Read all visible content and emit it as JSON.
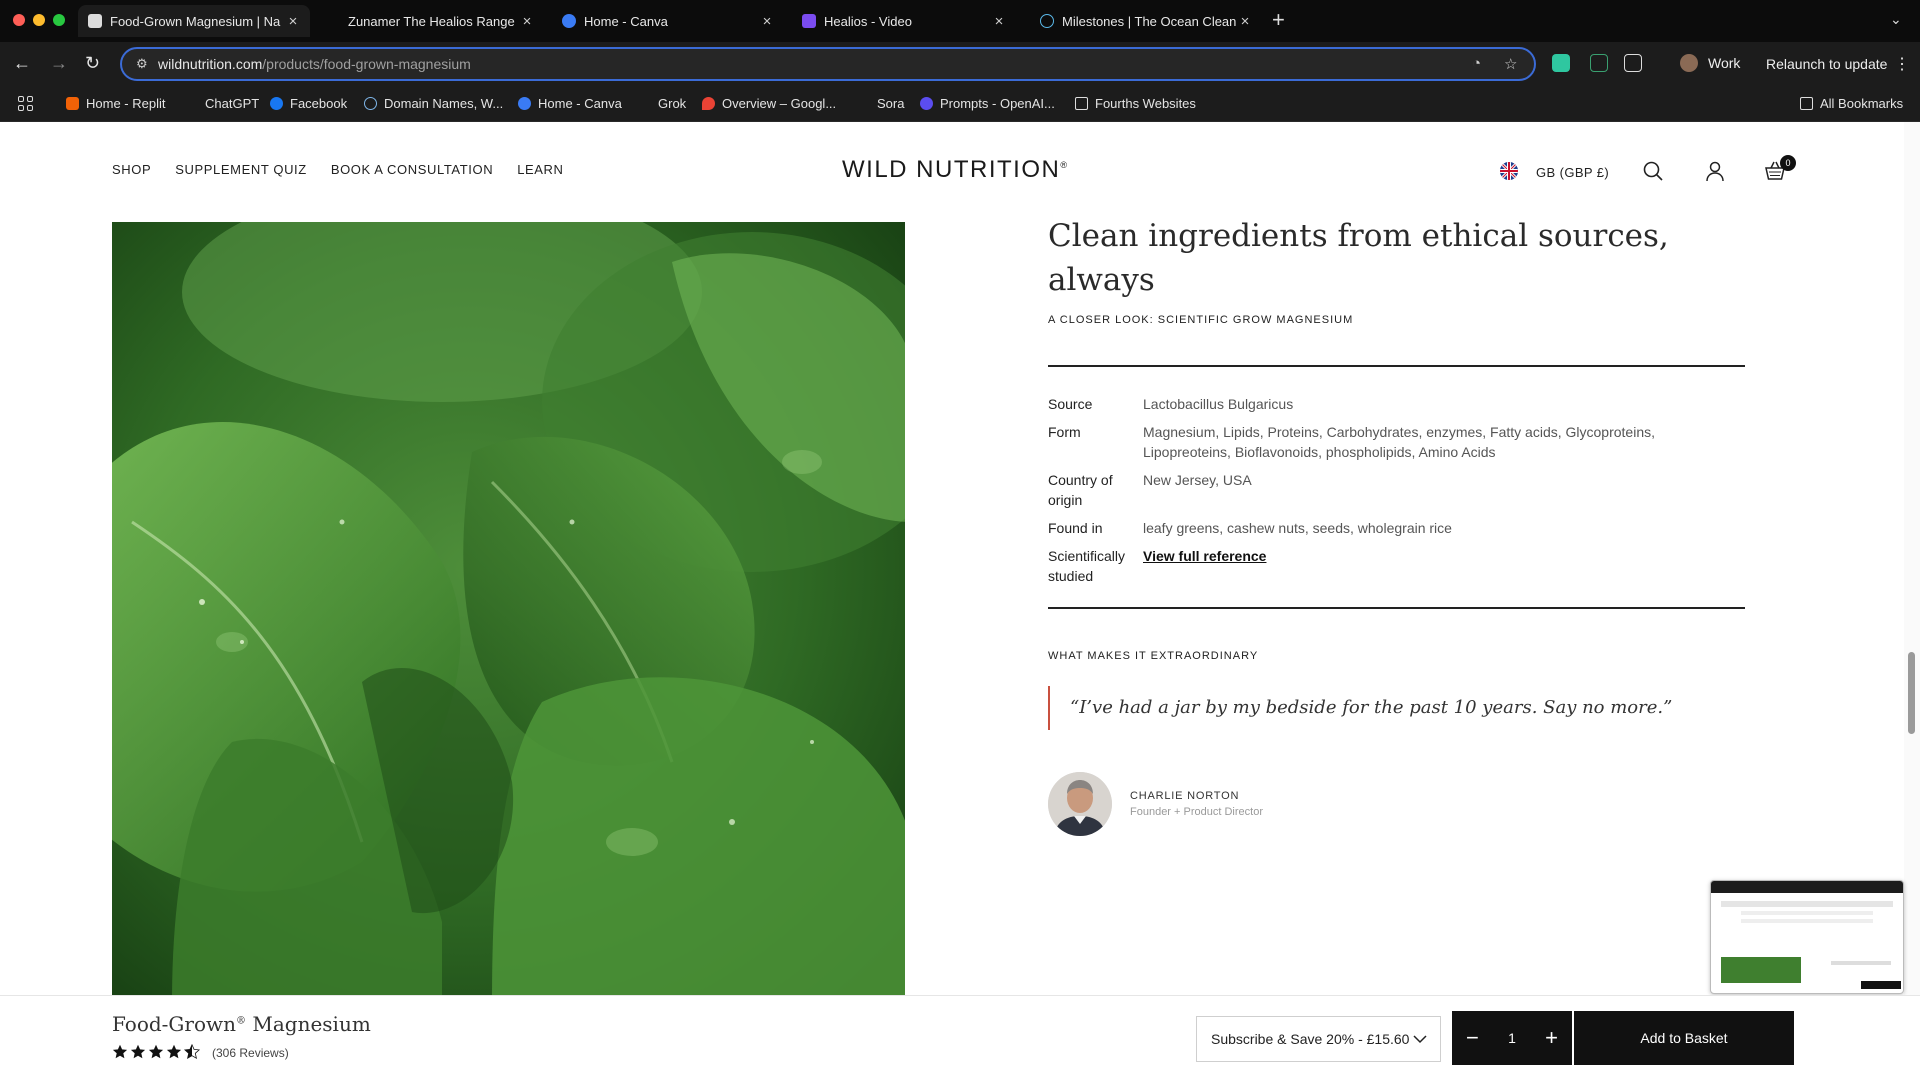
{
  "browser": {
    "tabs": [
      {
        "title": "Food-Grown Magnesium | Na",
        "active": true
      },
      {
        "title": "Zunamer The Healios Range",
        "active": false
      },
      {
        "title": "Home - Canva",
        "active": false
      },
      {
        "title": "Healios - Video",
        "active": false
      },
      {
        "title": "Milestones | The Ocean Clean",
        "active": false
      }
    ],
    "new_tab": "+",
    "url_host": "wildnutrition.com",
    "url_path": "/products/food-grown-magnesium",
    "profile_label": "Work",
    "relaunch_label": "Relaunch to update",
    "bookmarks": [
      "Home - Replit",
      "ChatGPT",
      "Facebook",
      "Domain Names, W...",
      "Home - Canva",
      "Grok",
      "Overview – Googl...",
      "Sora",
      "Prompts - OpenAI...",
      "Fourths Websites"
    ],
    "all_bookmarks": "All Bookmarks"
  },
  "header": {
    "nav": [
      "SHOP",
      "SUPPLEMENT QUIZ",
      "BOOK A CONSULTATION",
      "LEARN"
    ],
    "brand": "WILD NUTRITION",
    "brand_mark": "®",
    "currency": "GB (GBP £)",
    "cart_count": "0"
  },
  "main": {
    "heading": "Clean ingredients from ethical sources, always",
    "closer_look": "A CLOSER LOOK: SCIENTIFIC GROW MAGNESIUM",
    "specs": [
      {
        "label": "Source",
        "value": "Lactobacillus Bulgaricus"
      },
      {
        "label": "Form",
        "value": "Magnesium, Lipids, Proteins, Carbohydrates, enzymes, Fatty acids, Glycoproteins, Lipopreoteins, Bioflavonoids, phospholipids, Amino Acids"
      },
      {
        "label": "Country of origin",
        "value": "New Jersey, USA"
      },
      {
        "label": "Found in",
        "value": "leafy greens, cashew nuts, seeds, wholegrain rice"
      },
      {
        "label": "Scientifically studied",
        "value": "View full reference"
      }
    ],
    "extraordinary_label": "WHAT MAKES IT EXTRAORDINARY",
    "quote": "“I’ve had a jar by my bedside for the past 10 years. Say no more.”",
    "author_name": "CHARLIE NORTON",
    "author_role": "Founder + Product Director"
  },
  "sticky_bar": {
    "product_name": "Food-Grown",
    "product_mark": "®",
    "product_name_suffix": " Magnesium",
    "rating": 4.5,
    "reviews": "(306 Reviews)",
    "subscription": "Subscribe & Save 20% - £15.60",
    "quantity": "1",
    "add_to_basket": "Add to Basket"
  },
  "colors": {
    "accent_quote": "#c9503f",
    "omnibox_border": "#3b6bd6",
    "button": "#111111"
  }
}
